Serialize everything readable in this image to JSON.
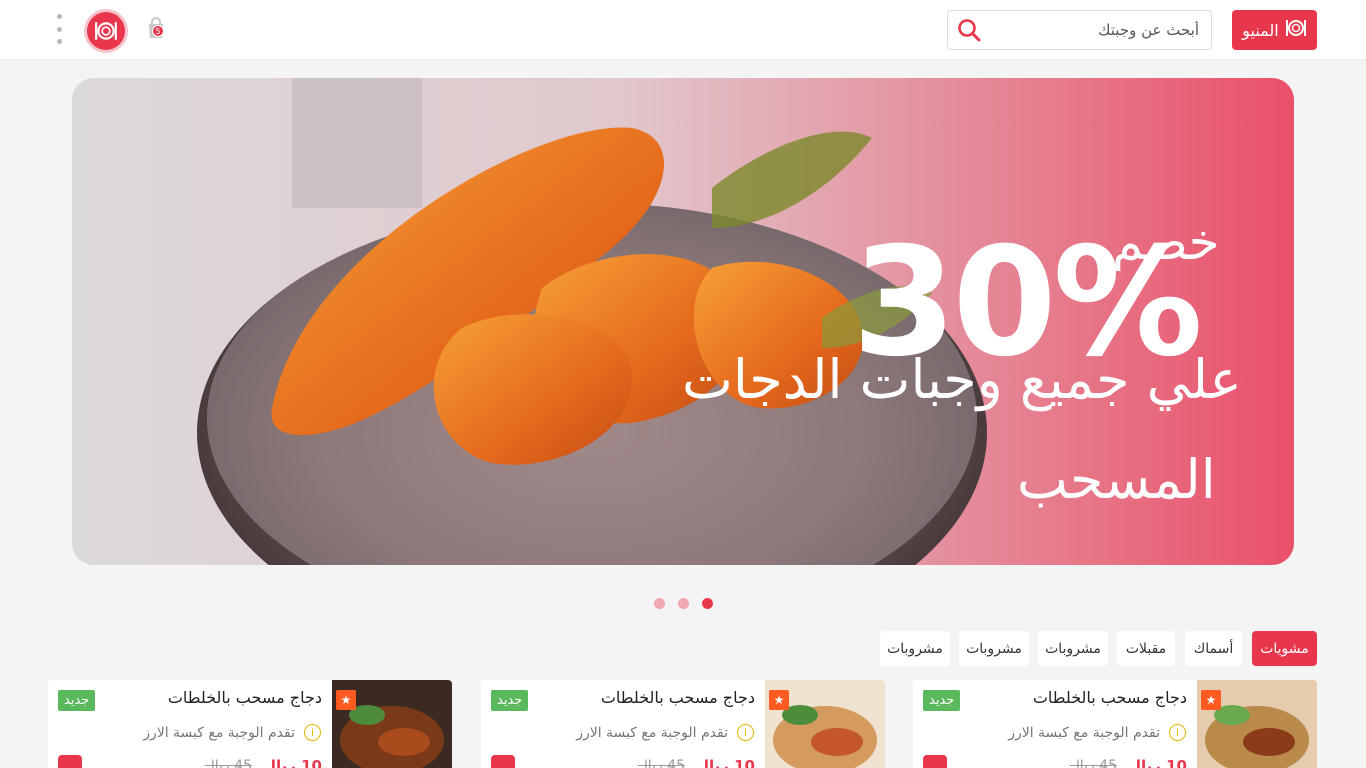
{
  "header": {
    "menu_label": "المنيو",
    "search_placeholder": "أبحث عن وجبتك",
    "cart_count": "5"
  },
  "banner": {
    "discount_label": "خصم",
    "discount_value": "30%",
    "line1": "علي جميع وجبات الدجات",
    "line2": "المسحب"
  },
  "carousel": {
    "total": 3,
    "active_index": 1
  },
  "categories": [
    {
      "label": "مشويات",
      "active": true
    },
    {
      "label": "أسماك",
      "active": false
    },
    {
      "label": "مقبلات",
      "active": false
    },
    {
      "label": "مشروبات",
      "active": false
    },
    {
      "label": "مشروبات",
      "active": false
    },
    {
      "label": "مشروبات",
      "active": false
    }
  ],
  "products": [
    {
      "title": "دجاج مسحب بالخلطات",
      "badge": "جديد",
      "desc": "تقدم الوجبة مع كبسة الارز",
      "price": "10 ريال",
      "old_price": "45 ريال"
    },
    {
      "title": "دجاج مسحب بالخلطات",
      "badge": "جديد",
      "desc": "تقدم الوجبة مع كبسة الارز",
      "price": "10 ريال",
      "old_price": "45 ريال"
    },
    {
      "title": "دجاج مسحب بالخلطات",
      "badge": "جديد",
      "desc": "تقدم الوجبة مع كبسة الارز",
      "price": "10 ريال",
      "old_price": "45 ريال"
    }
  ],
  "colors": {
    "accent": "#e8374d",
    "badge_green": "#5cb85c",
    "star_orange": "#ff5a1f"
  },
  "icons": {
    "menu": "plate-fork-knife-icon",
    "search": "search-icon",
    "cart": "shopping-bag-icon",
    "more": "kebab-menu-icon",
    "info": "info-icon",
    "star": "star-icon"
  }
}
